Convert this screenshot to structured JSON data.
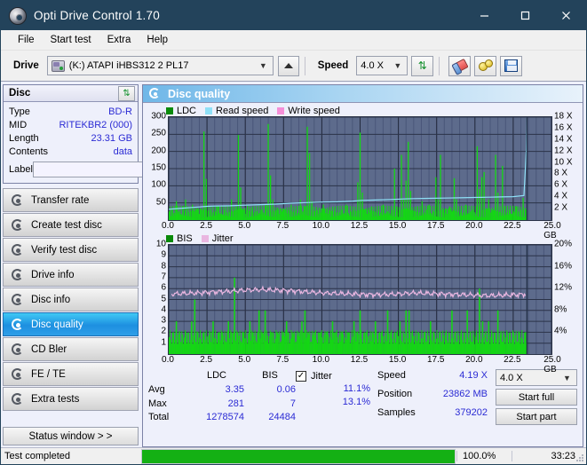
{
  "window": {
    "title": "Opti Drive Control 1.70",
    "icon": "disc-icon",
    "minimize": "minimize-icon",
    "maximize": "maximize-icon",
    "close": "close-icon"
  },
  "menu": {
    "items": [
      "File",
      "Start test",
      "Extra",
      "Help"
    ]
  },
  "toolbar": {
    "drive_label": "Drive",
    "drive_value": "(K:)  ATAPI iHBS312  2 PL17",
    "eject_icon": "eject-icon",
    "speed_label": "Speed",
    "speed_value": "4.0 X",
    "refresh_icon": "refresh-icon",
    "eraser_icon": "eraser-icon",
    "gears_icon": "gears-icon",
    "save_icon": "save-icon"
  },
  "sidebar": {
    "disc_panel": {
      "title": "Disc",
      "refresh_icon": "refresh-icon",
      "rows": [
        {
          "key": "Type",
          "value": "BD-R"
        },
        {
          "key": "MID",
          "value": "RITEKBR2 (000)"
        },
        {
          "key": "Length",
          "value": "23.31 GB"
        },
        {
          "key": "Contents",
          "value": "data"
        }
      ],
      "label_key": "Label",
      "label_value": "",
      "label_placeholder": "",
      "disc_button_icon": "disc-icon"
    },
    "nav": [
      {
        "label": "Transfer rate",
        "selected": false
      },
      {
        "label": "Create test disc",
        "selected": false
      },
      {
        "label": "Verify test disc",
        "selected": false
      },
      {
        "label": "Drive info",
        "selected": false
      },
      {
        "label": "Disc info",
        "selected": false
      },
      {
        "label": "Disc quality",
        "selected": true
      },
      {
        "label": "CD Bler",
        "selected": false
      },
      {
        "label": "FE / TE",
        "selected": false
      },
      {
        "label": "Extra tests",
        "selected": false
      }
    ],
    "status_window_button": "Status window > >"
  },
  "main": {
    "header_title": "Disc quality",
    "header_icon": "disc-quality-icon"
  },
  "stats": {
    "columns": [
      "LDC",
      "BIS"
    ],
    "rows": [
      {
        "key": "Avg",
        "ldc": "3.35",
        "bis": "0.06"
      },
      {
        "key": "Max",
        "ldc": "281",
        "bis": "7"
      },
      {
        "key": "Total",
        "ldc": "1278574",
        "bis": "24484"
      }
    ],
    "jitter": {
      "label": "Jitter",
      "checked": true,
      "avg": "11.1%",
      "max": "13.1%"
    },
    "readout": [
      {
        "key": "Speed",
        "value": "4.19 X"
      },
      {
        "key": "Position",
        "value": "23862 MB"
      },
      {
        "key": "Samples",
        "value": "379202"
      }
    ],
    "speed_select": "4.0 X",
    "start_full": "Start full",
    "start_part": "Start part"
  },
  "statusbar": {
    "message": "Test completed",
    "progress_percent": "100.0%",
    "progress_value": 100,
    "elapsed": "33:23"
  },
  "colors": {
    "titlebar": "#23435b",
    "accent_selected": "#1d8fe0",
    "plot_bg": "#5d6b8c",
    "grid": "#2b3348",
    "ldc_green": "#14d714",
    "bis_green": "#14d714",
    "read_speed": "#8fe0f7",
    "write_speed": "#f58fd8",
    "jitter_pink": "#e9b6e0",
    "value_blue": "#2b2bd4",
    "progress_green": "#14b014"
  },
  "chart_data": [
    {
      "type": "line",
      "title": "LDC / Read speed",
      "legend": [
        {
          "label": "LDC",
          "color": "#0a8a0a"
        },
        {
          "label": "Read speed",
          "color": "#8fe0f7"
        },
        {
          "label": "Write speed",
          "color": "#f58fd8"
        }
      ],
      "legend_position": "top-left",
      "xlabel": "GB",
      "xlim": [
        0,
        25
      ],
      "xticks": [
        0.0,
        2.5,
        5.0,
        7.5,
        10.0,
        12.5,
        15.0,
        17.5,
        20.0,
        22.5,
        25.0
      ],
      "xticklabels": [
        "0.0",
        "2.5",
        "5.0",
        "7.5",
        "10.0",
        "12.5",
        "15.0",
        "17.5",
        "20.0",
        "22.5",
        "25.0"
      ],
      "ylabel": "LDC",
      "ylim": [
        0,
        300
      ],
      "yticks": [
        50,
        100,
        150,
        200,
        250,
        300
      ],
      "y2label": "X",
      "y2lim": [
        0,
        18
      ],
      "y2ticks": [
        2,
        4,
        6,
        8,
        10,
        12,
        14,
        16,
        18
      ],
      "y2ticklabels": [
        "2 X",
        "4 X",
        "6 X",
        "8 X",
        "10 X",
        "12 X",
        "14 X",
        "16 X",
        "18 X"
      ],
      "grid": true,
      "data_end_gb": 23.4,
      "series": [
        {
          "name": "LDC",
          "type": "bar",
          "color": "#14d714",
          "x": [
            0.05,
            0.2,
            0.35,
            0.5,
            0.65,
            0.8,
            0.95,
            1.1,
            1.25,
            1.4,
            1.55,
            1.7,
            1.85,
            2.0,
            2.15,
            2.3,
            2.45,
            2.6,
            2.75,
            2.9,
            3.05,
            3.2,
            3.35,
            3.5,
            3.65,
            3.8,
            3.95,
            4.1,
            4.25,
            4.4,
            4.55,
            4.7,
            4.85,
            5.0,
            5.15,
            5.3,
            5.45,
            5.6,
            5.75,
            5.9,
            6.05,
            6.2,
            6.35,
            6.5,
            6.65,
            6.8,
            6.95,
            7.1,
            7.25,
            7.4,
            7.55,
            7.7,
            7.85,
            8.0,
            8.15,
            8.3,
            8.45,
            8.6,
            8.75,
            8.9,
            9.05,
            9.2,
            9.35,
            9.5,
            9.65,
            9.8,
            9.95,
            10.1,
            10.25,
            10.4,
            10.55,
            10.7,
            10.85,
            11.0,
            11.15,
            11.3,
            11.45,
            11.6,
            11.75,
            11.9,
            12.05,
            12.2,
            12.35,
            12.5,
            12.65,
            12.8,
            12.95,
            13.1,
            13.25,
            13.4,
            13.55,
            13.7,
            13.85,
            14.0,
            14.15,
            14.3,
            14.45,
            14.6,
            14.75,
            14.9,
            15.05,
            15.2,
            15.35,
            15.5,
            15.65,
            15.8,
            15.95,
            16.1,
            16.25,
            16.4,
            16.55,
            16.7,
            16.85,
            17.0,
            17.15,
            17.3,
            17.45,
            17.6,
            17.75,
            17.9,
            18.05,
            18.2,
            18.35,
            18.5,
            18.65,
            18.8,
            18.95,
            19.1,
            19.25,
            19.4,
            19.55,
            19.7,
            19.85,
            20.0,
            20.15,
            20.3,
            20.45,
            20.6,
            20.75,
            20.9,
            21.05,
            21.2,
            21.35,
            21.5,
            21.65,
            21.8,
            21.95,
            22.1,
            22.25,
            22.4,
            22.55,
            22.7,
            22.85,
            23.0,
            23.15,
            23.3
          ],
          "values": [
            22,
            30,
            20,
            55,
            25,
            18,
            40,
            60,
            35,
            20,
            45,
            25,
            32,
            18,
            28,
            258,
            120,
            22,
            30,
            18,
            25,
            40,
            20,
            15,
            30,
            22,
            18,
            60,
            25,
            40,
            248,
            95,
            30,
            18,
            42,
            22,
            35,
            18,
            26,
            20,
            30,
            22,
            45,
            280,
            130,
            60,
            22,
            35,
            18,
            25,
            30,
            20,
            18,
            45,
            22,
            30,
            18,
            60,
            25,
            40,
            272,
            195,
            55,
            25,
            30,
            18,
            22,
            45,
            20,
            18,
            30,
            25,
            35,
            18,
            22,
            30,
            20,
            45,
            18,
            25,
            30,
            20,
            110,
            255,
            80,
            30,
            18,
            22,
            40,
            25,
            18,
            30,
            22,
            45,
            20,
            25,
            18,
            30,
            150,
            40,
            22,
            190,
            60,
            115,
            228,
            85,
            30,
            25,
            40,
            18,
            55,
            22,
            30,
            45,
            18,
            25,
            125,
            60,
            190,
            30,
            22,
            18,
            40,
            25,
            122,
            60,
            18,
            30,
            22,
            45,
            20,
            25,
            30,
            18,
            215,
            90,
            125,
            140,
            35,
            60,
            22,
            30,
            190,
            80,
            25,
            158,
            40,
            22,
            30,
            18,
            25,
            40,
            20,
            30,
            65,
            22
          ]
        },
        {
          "name": "Read speed",
          "type": "line",
          "color": "#8fe0f7",
          "axis": "right",
          "x": [
            0.0,
            0.5,
            1.0,
            1.5,
            2.0,
            2.5,
            3.0,
            4.0,
            5.0,
            6.0,
            7.0,
            8.0,
            9.0,
            10.0,
            11.0,
            12.0,
            12.6,
            13.5,
            14.5,
            15.3,
            16.0,
            17.0,
            18.0,
            19.0,
            20.0,
            21.0,
            21.7,
            22.5,
            23.2,
            23.35,
            23.4
          ],
          "values": [
            1.9,
            2.0,
            2.1,
            2.2,
            2.3,
            2.4,
            2.45,
            2.5,
            2.6,
            2.7,
            2.8,
            2.95,
            3.05,
            3.15,
            3.2,
            3.3,
            3.45,
            3.5,
            3.6,
            3.7,
            3.75,
            3.8,
            3.85,
            3.9,
            3.95,
            4.0,
            4.05,
            4.1,
            4.3,
            12.0,
            18.0
          ]
        },
        {
          "name": "Write speed",
          "type": "line",
          "color": "#f58fd8",
          "x": [],
          "values": []
        }
      ]
    },
    {
      "type": "line",
      "title": "BIS / Jitter",
      "legend": [
        {
          "label": "BIS",
          "color": "#0a8a0a"
        },
        {
          "label": "Jitter",
          "color": "#e9b6e0"
        }
      ],
      "legend_position": "top-left",
      "xlabel": "GB",
      "xlim": [
        0,
        25
      ],
      "xticks": [
        0.0,
        2.5,
        5.0,
        7.5,
        10.0,
        12.5,
        15.0,
        17.5,
        20.0,
        22.5,
        25.0
      ],
      "xticklabels": [
        "0.0",
        "2.5",
        "5.0",
        "7.5",
        "10.0",
        "12.5",
        "15.0",
        "17.5",
        "20.0",
        "22.5",
        "25.0"
      ],
      "ylabel": "BIS",
      "ylim": [
        0,
        10
      ],
      "yticks": [
        1,
        2,
        3,
        4,
        5,
        6,
        7,
        8,
        9,
        10
      ],
      "y2label": "%",
      "y2lim": [
        0,
        20
      ],
      "y2ticks": [
        4,
        8,
        12,
        16,
        20
      ],
      "y2ticklabels": [
        "4%",
        "8%",
        "12%",
        "16%",
        "20%"
      ],
      "grid": true,
      "data_end_gb": 23.4,
      "series": [
        {
          "name": "BIS",
          "type": "bar",
          "color": "#14d714",
          "x": [
            0.1,
            0.3,
            0.5,
            0.7,
            0.9,
            1.1,
            1.3,
            1.5,
            1.7,
            1.9,
            2.1,
            2.3,
            2.5,
            2.7,
            2.9,
            3.1,
            3.3,
            3.5,
            3.7,
            3.9,
            4.1,
            4.3,
            4.5,
            4.7,
            4.9,
            5.1,
            5.3,
            5.5,
            5.7,
            5.9,
            6.1,
            6.3,
            6.5,
            6.7,
            6.9,
            7.1,
            7.3,
            7.5,
            7.7,
            7.9,
            8.1,
            8.3,
            8.5,
            8.7,
            8.9,
            9.1,
            9.3,
            9.5,
            9.7,
            9.9,
            10.1,
            10.3,
            10.5,
            10.7,
            10.9,
            11.1,
            11.3,
            11.5,
            11.7,
            11.9,
            12.1,
            12.3,
            12.5,
            12.7,
            12.9,
            13.1,
            13.3,
            13.5,
            13.7,
            13.9,
            14.1,
            14.3,
            14.5,
            14.7,
            14.9,
            15.1,
            15.3,
            15.5,
            15.7,
            15.9,
            16.1,
            16.3,
            16.5,
            16.7,
            16.9,
            17.1,
            17.3,
            17.5,
            17.7,
            17.9,
            18.1,
            18.3,
            18.5,
            18.7,
            18.9,
            19.1,
            19.3,
            19.5,
            19.7,
            19.9,
            20.1,
            20.3,
            20.5,
            20.7,
            20.9,
            21.1,
            21.3,
            21.5,
            21.7,
            21.9,
            22.1,
            22.3,
            22.5,
            22.7,
            22.9,
            23.1,
            23.3
          ],
          "values": [
            1,
            2,
            3,
            2,
            1,
            2,
            1,
            3,
            5,
            2,
            1,
            2,
            1,
            2,
            3,
            1,
            2,
            2,
            1,
            3,
            2,
            7,
            2,
            1,
            2,
            1,
            3,
            2,
            1,
            4,
            2,
            4,
            1,
            2,
            1,
            2,
            1,
            2,
            3,
            1,
            2,
            1,
            2,
            3,
            4,
            2,
            1,
            2,
            1,
            2,
            1,
            2,
            1,
            3,
            2,
            1,
            2,
            1,
            2,
            1,
            3,
            2,
            4,
            1,
            2,
            1,
            2,
            3,
            1,
            2,
            1,
            4,
            2,
            1,
            2,
            3,
            1,
            4,
            4,
            2,
            1,
            2,
            1,
            2,
            1,
            3,
            2,
            1,
            2,
            1,
            2,
            1,
            4,
            2,
            1,
            2,
            1,
            4,
            2,
            1,
            2,
            6,
            3,
            2,
            3,
            2,
            1,
            4,
            2,
            1,
            2,
            1,
            2,
            1,
            2,
            1,
            2
          ]
        },
        {
          "name": "Jitter",
          "type": "line",
          "color": "#e9b6e0",
          "axis": "right",
          "x": [
            0.2,
            1.0,
            2.0,
            3.0,
            4.0,
            5.0,
            6.0,
            7.0,
            8.0,
            9.0,
            10.0,
            11.0,
            12.0,
            13.0,
            14.0,
            15.0,
            16.0,
            17.0,
            18.0,
            19.0,
            20.0,
            21.0,
            22.0,
            23.0,
            23.35
          ],
          "values": [
            11.0,
            11.1,
            11.2,
            11.4,
            11.5,
            11.7,
            11.8,
            11.7,
            11.6,
            11.4,
            11.2,
            11.1,
            11.0,
            10.9,
            10.9,
            11.0,
            11.2,
            11.1,
            11.0,
            10.9,
            10.8,
            10.7,
            10.8,
            10.9,
            11.0
          ]
        }
      ]
    }
  ]
}
